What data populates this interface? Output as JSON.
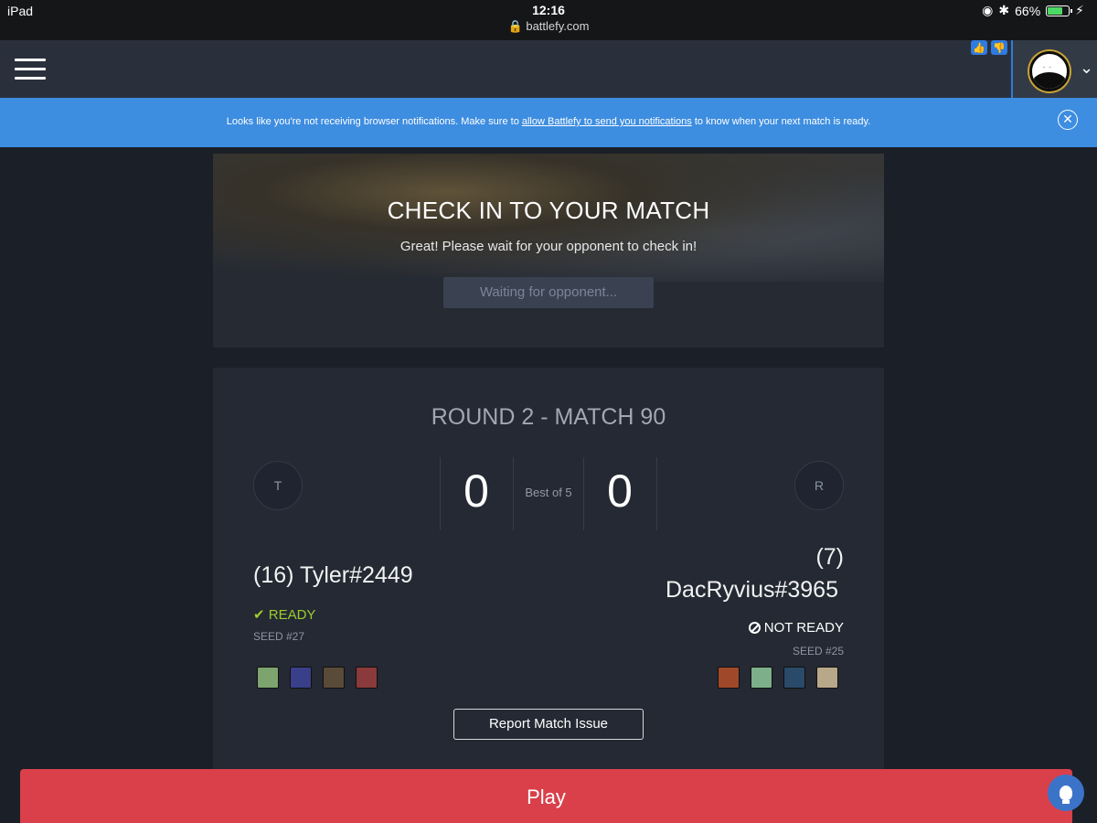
{
  "statusbar": {
    "device": "iPad",
    "time": "12:16",
    "url": "battlefy.com",
    "battery": "66%"
  },
  "banner": {
    "text_before": "Looks like you're not receiving browser notifications. Make sure to ",
    "link": "allow Battlefy to send you notifications",
    "text_after": " to know when your next match is ready.",
    "close": "✕"
  },
  "checkin": {
    "title": "CHECK IN TO YOUR MATCH",
    "subtitle": "Great! Please wait for your opponent to check in!",
    "button": "Waiting for opponent..."
  },
  "match": {
    "round": "ROUND 2 - MATCH 90",
    "best_of": "Best of 5",
    "left": {
      "initial": "T",
      "score": "0",
      "name": "(16) Tyler#2449",
      "status": "READY",
      "seed": "SEED #27",
      "heroes": [
        "#7da36e",
        "#3a3f8a",
        "#5a4a38",
        "#8a3a3a"
      ]
    },
    "right": {
      "initial": "R",
      "score": "0",
      "name_seed": "(7)",
      "name": "DacRyvius#3965",
      "status": "NOT READY",
      "seed": "SEED #25",
      "heroes": [
        "#a0482a",
        "#7db08a",
        "#2a4a6a",
        "#b8a88a"
      ]
    },
    "report_button": "Report Match Issue"
  },
  "play_button": "Play",
  "colors": {
    "accent": "#3d8de0",
    "play": "#d9404a",
    "ready": "#9ccc2e"
  }
}
